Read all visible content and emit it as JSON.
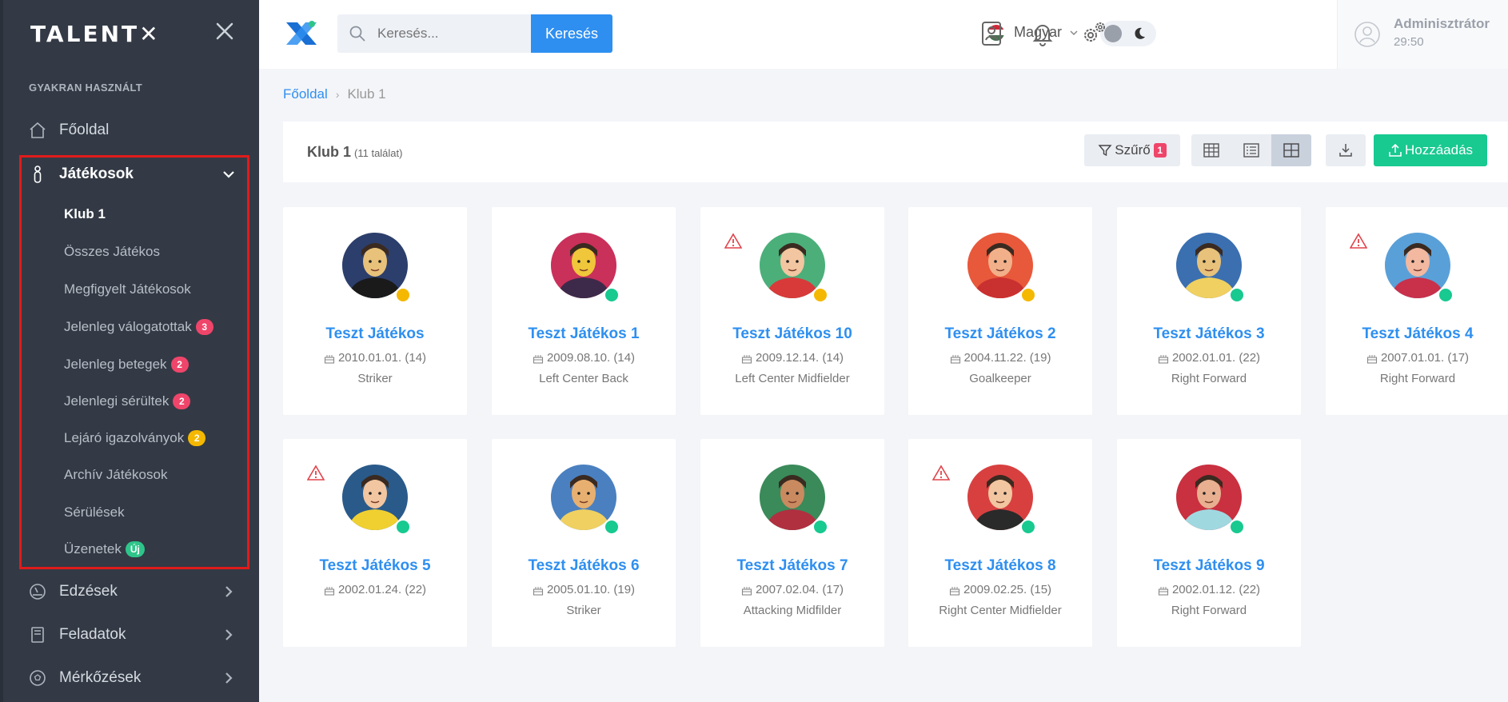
{
  "app": {
    "logo_text": "TALENT"
  },
  "sidebar": {
    "section_title": "GYAKRAN HASZNÁLT",
    "home_label": "Főoldal",
    "players_label": "Játékosok",
    "sub_items": [
      {
        "label": "Klub 1",
        "badge": null
      },
      {
        "label": "Összes Játékos",
        "badge": null
      },
      {
        "label": "Megfigyelt Játékosok",
        "badge": null
      },
      {
        "label": "Jelenleg válogatottak",
        "badge": "3"
      },
      {
        "label": "Jelenleg betegek",
        "badge": "2"
      },
      {
        "label": "Jelenlegi sérültek",
        "badge": "2"
      },
      {
        "label": "Lejáró igazolványok",
        "badge": "2"
      },
      {
        "label": "Archív Játékosok",
        "badge": null
      },
      {
        "label": "Sérülések",
        "badge": null
      },
      {
        "label": "Üzenetek",
        "badge": "Új"
      }
    ],
    "trainings_label": "Edzések",
    "tasks_label": "Feladatok",
    "matches_label": "Mérkőzések"
  },
  "topbar": {
    "search_placeholder": "Keresés...",
    "search_button": "Keresés",
    "language": "Magyar",
    "user_name": "Adminisztrátor",
    "user_time": "29:50"
  },
  "breadcrumb": {
    "home": "Főoldal",
    "current": "Klub 1"
  },
  "header": {
    "title": "Klub 1",
    "count": "(11 találat)",
    "filter_label": "Szűrő",
    "filter_badge": "1",
    "add_label": "Hozzáadás"
  },
  "colors": {
    "accent": "#2e8ff0",
    "success": "#18c990",
    "status_yellow": "#f5b800",
    "status_green": "#18c990",
    "warning_red": "#e0434b"
  },
  "players": [
    {
      "name": "Teszt Játékos",
      "date": "2010.01.01. (14)",
      "position": "Striker",
      "status": "yellow",
      "warning": false
    },
    {
      "name": "Teszt Játékos 1",
      "date": "2009.08.10. (14)",
      "position": "Left Center Back",
      "status": "green",
      "warning": false
    },
    {
      "name": "Teszt Játékos 10",
      "date": "2009.12.14. (14)",
      "position": "Left Center Midfielder",
      "status": "yellow",
      "warning": true
    },
    {
      "name": "Teszt Játékos 2",
      "date": "2004.11.22. (19)",
      "position": "Goalkeeper",
      "status": "yellow",
      "warning": false
    },
    {
      "name": "Teszt Játékos 3",
      "date": "2002.01.01. (22)",
      "position": "Right Forward",
      "status": "green",
      "warning": false
    },
    {
      "name": "Teszt Játékos 4",
      "date": "2007.01.01. (17)",
      "position": "Right Forward",
      "status": "green",
      "warning": true
    },
    {
      "name": "Teszt Játékos 5",
      "date": "2002.01.24. (22)",
      "position": "",
      "status": "green",
      "warning": true
    },
    {
      "name": "Teszt Játékos 6",
      "date": "2005.01.10. (19)",
      "position": "Striker",
      "status": "green",
      "warning": false
    },
    {
      "name": "Teszt Játékos 7",
      "date": "2007.02.04. (17)",
      "position": "Attacking Midfilder",
      "status": "green",
      "warning": false
    },
    {
      "name": "Teszt Játékos 8",
      "date": "2009.02.25. (15)",
      "position": "Right Center Midfielder",
      "status": "green",
      "warning": true
    },
    {
      "name": "Teszt Játékos 9",
      "date": "2002.01.12. (22)",
      "position": "Right Forward",
      "status": "green",
      "warning": false
    }
  ]
}
